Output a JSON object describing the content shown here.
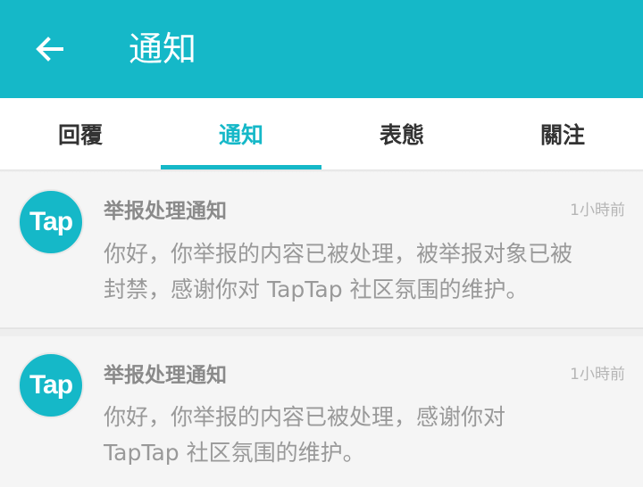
{
  "header": {
    "back_icon": "arrow-left-icon",
    "title": "通知"
  },
  "tabs": [
    {
      "label": "回覆",
      "active": false
    },
    {
      "label": "通知",
      "active": true
    },
    {
      "label": "表態",
      "active": false
    },
    {
      "label": "關注",
      "active": false
    }
  ],
  "notifications": [
    {
      "avatar_text": "Tap",
      "title": "举报处理通知",
      "time": "1小時前",
      "body_line1": "你好，你举报的内容已被处理，被举报对象已被",
      "body_line2": "封禁，感谢你对 TapTap 社区氛围的维护。"
    },
    {
      "avatar_text": "Tap",
      "title": "举报处理通知",
      "time": "1小時前",
      "body_line1": "你好，你举报的内容已被处理，感谢你对",
      "body_line2": "TapTap 社区氛围的维护。"
    }
  ],
  "colors": {
    "accent": "#15b8c8",
    "card_bg": "#f5f5f5",
    "text_muted": "#999999"
  }
}
